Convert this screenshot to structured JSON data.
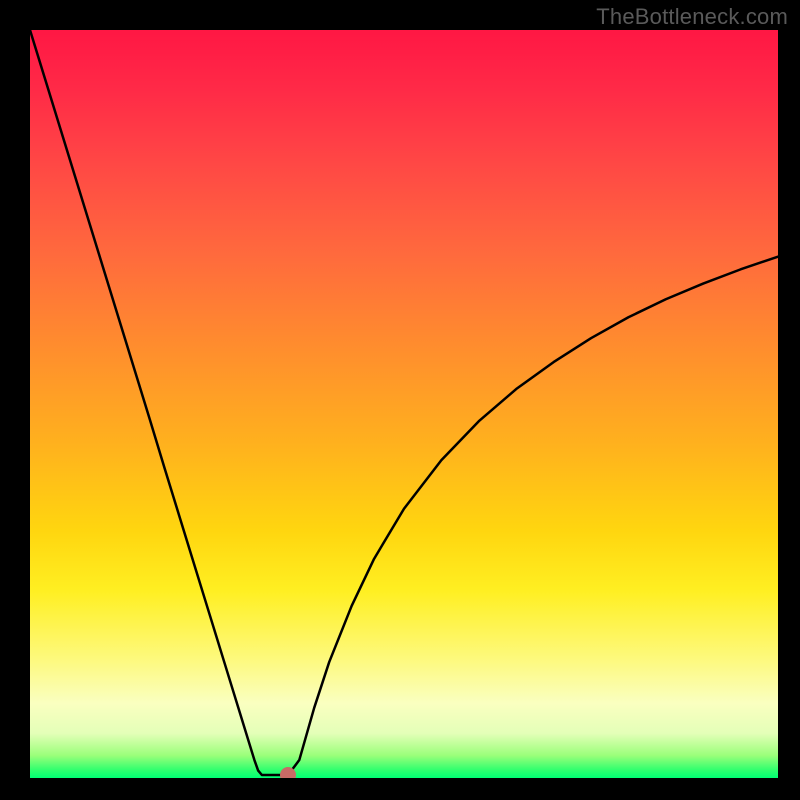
{
  "watermark": "TheBottleneck.com",
  "chart_data": {
    "type": "line",
    "title": "",
    "xlabel": "",
    "ylabel": "",
    "xlim": [
      0,
      1
    ],
    "ylim": [
      0,
      1
    ],
    "background_gradient": {
      "top": "#ff1744",
      "bottom": "#00ff73"
    },
    "x": [
      0.0,
      0.02,
      0.04,
      0.06,
      0.08,
      0.1,
      0.12,
      0.14,
      0.16,
      0.18,
      0.2,
      0.22,
      0.24,
      0.26,
      0.28,
      0.3,
      0.305,
      0.31,
      0.32,
      0.33,
      0.345,
      0.36,
      0.38,
      0.4,
      0.43,
      0.46,
      0.5,
      0.55,
      0.6,
      0.65,
      0.7,
      0.75,
      0.8,
      0.85,
      0.9,
      0.95,
      1.0
    ],
    "y": [
      1.0,
      0.935,
      0.87,
      0.805,
      0.74,
      0.675,
      0.61,
      0.545,
      0.48,
      0.414,
      0.349,
      0.284,
      0.219,
      0.154,
      0.089,
      0.024,
      0.01,
      0.004,
      0.004,
      0.004,
      0.004,
      0.024,
      0.094,
      0.155,
      0.23,
      0.293,
      0.36,
      0.425,
      0.477,
      0.52,
      0.556,
      0.588,
      0.616,
      0.64,
      0.661,
      0.68,
      0.697
    ],
    "annotations": [
      {
        "type": "marker",
        "x": 0.345,
        "y": 0.004,
        "color": "#c96a66"
      }
    ]
  },
  "marker": {
    "left_pct": 34.5,
    "top_pct": 99.6
  },
  "colors": {
    "curve": "#000000",
    "background": "#000000"
  }
}
